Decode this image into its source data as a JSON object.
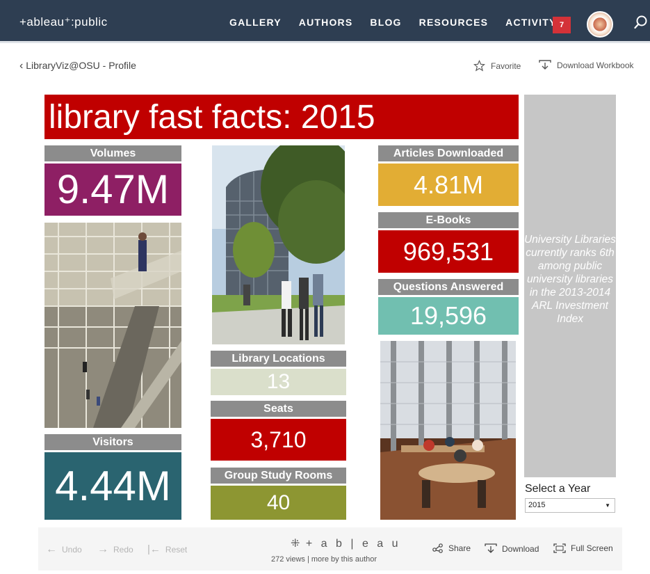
{
  "nav": {
    "logo": "+ableau⁺:public",
    "links": [
      "GALLERY",
      "AUTHORS",
      "BLOG",
      "RESOURCES",
      "ACTIVITY"
    ],
    "activity_count": "7"
  },
  "subheader": {
    "back_label": "LibraryViz@OSU - Profile",
    "favorite_label": "Favorite",
    "download_workbook_label": "Download Workbook"
  },
  "viz": {
    "title": "library fast facts:  2015",
    "volumes": {
      "label": "Volumes",
      "value": "9.47M"
    },
    "visitors": {
      "label": "Visitors",
      "value": "4.44M"
    },
    "library_locations": {
      "label": "Library Locations",
      "value": "13"
    },
    "seats": {
      "label": "Seats",
      "value": "3,710"
    },
    "group_study_rooms": {
      "label": "Group Study Rooms",
      "value": "40"
    },
    "articles_downloaded": {
      "label": "Articles Downloaded",
      "value": "4.81M"
    },
    "ebooks": {
      "label": "E-Books",
      "value": "969,531"
    },
    "questions_answered": {
      "label": "Questions Answered",
      "value": "19,596"
    },
    "side_note": "University Libraries currently ranks 6th among public university libraries in the 2013-2014 ARL Investment Index",
    "year_filter": {
      "label": "Select a Year",
      "selected": "2015"
    },
    "colors": {
      "title_red": "#c00000",
      "volumes_purple": "#8e1f64",
      "visitors_teal": "#2a6470",
      "locations_sage": "#dadfcb",
      "seats_red": "#c00000",
      "study_olive": "#8d9632",
      "articles_gold": "#e2ad34",
      "ebooks_red": "#c00000",
      "questions_mint": "#71bfb0",
      "label_gray": "#8c8c8c"
    }
  },
  "toolbar": {
    "undo": "Undo",
    "redo": "Redo",
    "reset": "Reset",
    "brand": "+ a b | e a u",
    "views_text": "272 views  |  more by this author",
    "share": "Share",
    "download": "Download",
    "fullscreen": "Full Screen"
  }
}
